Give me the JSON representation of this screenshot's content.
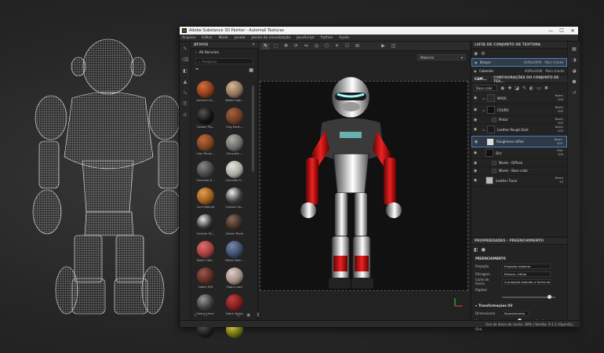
{
  "window": {
    "title": "Adobe Substance 3D Painter - Automali Texturas",
    "logo": "Pt",
    "controls": [
      "—",
      "☐",
      "✕"
    ]
  },
  "menu": [
    "Arquivo",
    "Editar",
    "Modo",
    "Janela",
    "Janela de visualização",
    "JavaScript",
    "Python",
    "Ajuda"
  ],
  "assets": {
    "title": "ATIVOS",
    "libraries": "All libraries",
    "search_placeholder": "Pesquisar",
    "materials": [
      {
        "label": "Autumn Le...",
        "color": "#8a3a1a",
        "hi": "#d4703a"
      },
      {
        "label": "Baked Ligh...",
        "color": "#8a7058",
        "hi": "#d8b898"
      },
      {
        "label": "Carbon Fib...",
        "color": "#111111",
        "hi": "#555555"
      },
      {
        "label": "Clay Earth...",
        "color": "#6a3a22",
        "hi": "#a8623c"
      },
      {
        "label": "Clay Terrac...",
        "color": "#7a4020",
        "hi": "#c06a38"
      },
      {
        "label": "Concrete ...",
        "color": "#6a6a66",
        "hi": "#b0b0aa"
      },
      {
        "label": "Concrete G...",
        "color": "#444444",
        "hi": "#888888"
      },
      {
        "label": "Concrete S...",
        "color": "#a8a8a0",
        "hi": "#e6e6e0"
      },
      {
        "label": "Corn Natural",
        "color": "#9a5a1a",
        "hi": "#e0a050"
      },
      {
        "label": "Custom Sp...",
        "color": "#3a3a3a",
        "hi": "#eeeeee"
      },
      {
        "label": "Custom Sh...",
        "color": "#2a2a2a",
        "hi": "#e8e8e8"
      },
      {
        "label": "Denim Rivet",
        "color": "#3a2a22",
        "hi": "#8a6a5a"
      },
      {
        "label": "Fabric Cott...",
        "color": "#a03a3a",
        "hi": "#e07070"
      },
      {
        "label": "Fabric Deni...",
        "color": "#3a4a6a",
        "hi": "#7888aa"
      },
      {
        "label": "Fabric Felt",
        "color": "#5a2a22",
        "hi": "#9a5a4a"
      },
      {
        "label": "Fabric Lace",
        "color": "#9a8a80",
        "hi": "#e0d0c8"
      },
      {
        "label": "Fabric Linen",
        "color": "#3a3a3a",
        "hi": "#9a9a9a"
      },
      {
        "label": "Fabric Nylon",
        "color": "#7a1a1a",
        "hi": "#c04040"
      },
      {
        "label": "",
        "color": "#1a1a1a",
        "hi": "#555555"
      },
      {
        "label": "",
        "color": "#6a6a10",
        "hi": "#d0d040"
      }
    ]
  },
  "viewport": {
    "material_mode": "Material"
  },
  "texture_sets": {
    "title": "LISTA DE CONJUNTO DE TEXTURA",
    "items": [
      {
        "name": "Braços",
        "res": "4096x4096",
        "shader": "Main shader",
        "selected": true
      },
      {
        "name": "Cabeeita",
        "res": "4096x4096",
        "shader": "Main shader",
        "selected": false
      }
    ]
  },
  "layers_panel": {
    "tab_layers": "CAM...",
    "tab_settings": "CONFIGURAÇÕES DO CONJUNTO DE TEX...",
    "channel": "Base color",
    "layers": [
      {
        "name": "MÃOS",
        "blend": "Norm",
        "opacity": "100",
        "thumb": "#2a2a2a",
        "type": "folder"
      },
      {
        "name": "COURO",
        "blend": "Norm",
        "opacity": "100",
        "thumb": "#111111",
        "type": "folder"
      },
      {
        "name": "Pintar",
        "blend": "Norm",
        "opacity": "100",
        "thumb": "#333333",
        "type": "sub"
      },
      {
        "name": "Leather Rough Dark",
        "blend": "Norm",
        "opacity": "100",
        "thumb": "#1a1a1a",
        "type": "folder"
      },
      {
        "name": "Roughness refine",
        "blend": "Norm",
        "opacity": "100",
        "thumb": "#dddddd",
        "type": "selected"
      },
      {
        "name": "Dirt",
        "blend": "Pthr",
        "opacity": "100",
        "thumb": "#111111",
        "type": "layer"
      },
      {
        "name": "Níveis - Diffuse",
        "blend": "",
        "opacity": "",
        "thumb": "#333333",
        "type": "sub"
      },
      {
        "name": "Níveis - Base color",
        "blend": "",
        "opacity": "",
        "thumb": "#333333",
        "type": "sub"
      },
      {
        "name": "Leather Tauro",
        "blend": "Norm",
        "opacity": "15",
        "thumb": "#bbbbbb",
        "type": "layer"
      }
    ]
  },
  "properties": {
    "title": "PROPRIEDADES - PREENCHIMENTO",
    "section": "PREENCHIMENTO",
    "rows": [
      {
        "label": "Projeção",
        "value": "Projeção triplanar"
      },
      {
        "label": "Filtragem",
        "value": "Bilinear | Mildo"
      },
      {
        "label": "Corte de forma",
        "value": "A projeção estende a forma externa"
      }
    ],
    "hardness_label": "Rigidez",
    "uv_section": "Transformações UV",
    "dimension_label": "Dimensionar",
    "dimension_value": "Revestimento",
    "tiling_label": "Revestimento",
    "tiling_value": "1",
    "rotation_label": "Giro"
  },
  "status": "Uso do disco de cache:  38% | Versão: 9.1.1 (OpenGL)"
}
